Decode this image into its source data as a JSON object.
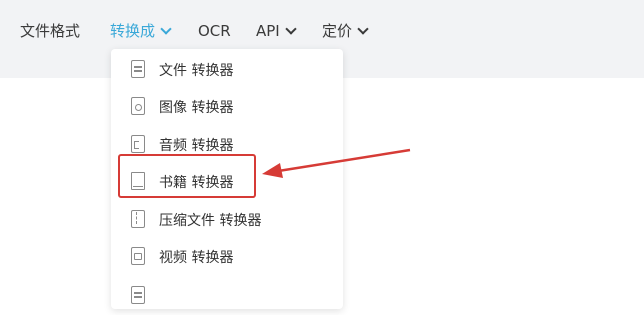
{
  "nav": {
    "file_formats": "文件格式",
    "convert_to": "转换成",
    "ocr": "OCR",
    "api": "API",
    "pricing": "定价"
  },
  "dropdown": {
    "items": [
      {
        "label": "文件 转换器",
        "icon": "document-icon"
      },
      {
        "label": "图像 转换器",
        "icon": "image-file-icon"
      },
      {
        "label": "音频 转换器",
        "icon": "audio-file-icon"
      },
      {
        "label": "书籍 转换器",
        "icon": "book-icon"
      },
      {
        "label": "压缩文件 转换器",
        "icon": "archive-file-icon"
      },
      {
        "label": "视频 转换器",
        "icon": "video-file-icon"
      }
    ]
  },
  "colors": {
    "nav_active": "#3aa8d8",
    "nav_background": "#f2f3f5",
    "annotation_red": "#d63b36"
  }
}
